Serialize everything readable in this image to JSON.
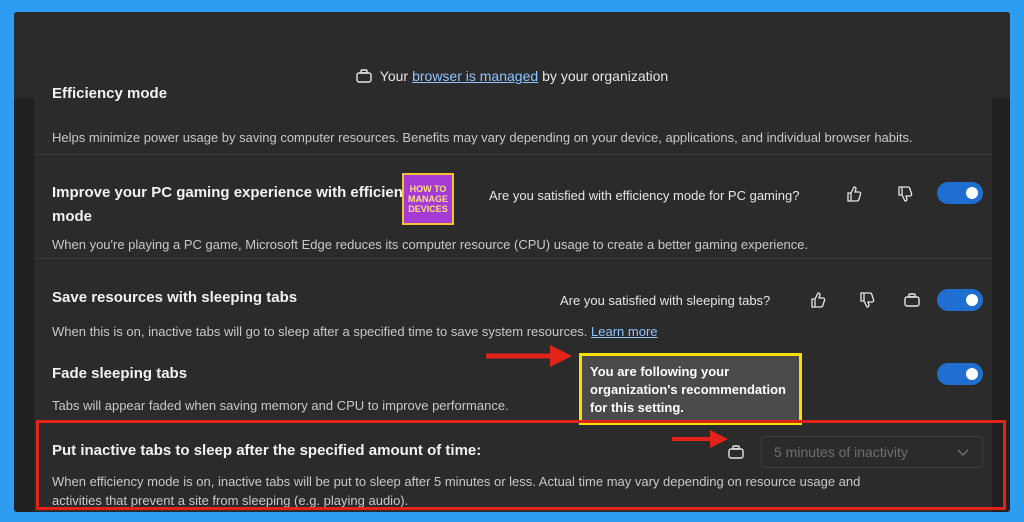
{
  "banner": {
    "prefix": "Your",
    "link": "browser is managed",
    "suffix": "by your organization"
  },
  "settings": {
    "efficiency": {
      "title_partial": "Efficiency mode",
      "desc": "Helps minimize power usage by saving computer resources. Benefits may vary depending on your device, applications, and individual browser habits."
    },
    "gaming": {
      "title_line1": "Improve your PC gaming experience with efficiency",
      "title_line2": "mode",
      "question": "Are you satisfied with efficiency mode for PC gaming?",
      "desc": "When you're playing a PC game, Microsoft Edge reduces its computer resource (CPU) usage to create a better gaming experience."
    },
    "sleeping": {
      "title": "Save resources with sleeping tabs",
      "question": "Are you satisfied with sleeping tabs?",
      "desc": "When this is on, inactive tabs will go to sleep after a specified time to save system resources.",
      "learn_more": "Learn more"
    },
    "fade": {
      "title": "Fade sleeping tabs",
      "desc": "Tabs will appear faded when saving memory and CPU to improve performance."
    },
    "inactive": {
      "title": "Put inactive tabs to sleep after the specified amount of time:",
      "select_value": "5 minutes of inactivity",
      "desc_line1": "When efficiency mode is on, inactive tabs will be put to sleep after 5 minutes or less. Actual time may vary depending on resource usage and",
      "desc_line2": "activities that prevent a site from sleeping (e.g. playing audio)."
    }
  },
  "tooltip": {
    "line1": "You are following your",
    "line2": "organization's recommendation",
    "line3": "for this setting."
  },
  "watermark": {
    "line1": "HOW TO",
    "line2": "MANAGE",
    "line3": "DEVICES"
  },
  "colors": {
    "toggle_on": "#1f6fd1",
    "annotation_red": "#e2231a",
    "tooltip_border": "#f5e000",
    "link": "#8fc4ff"
  }
}
